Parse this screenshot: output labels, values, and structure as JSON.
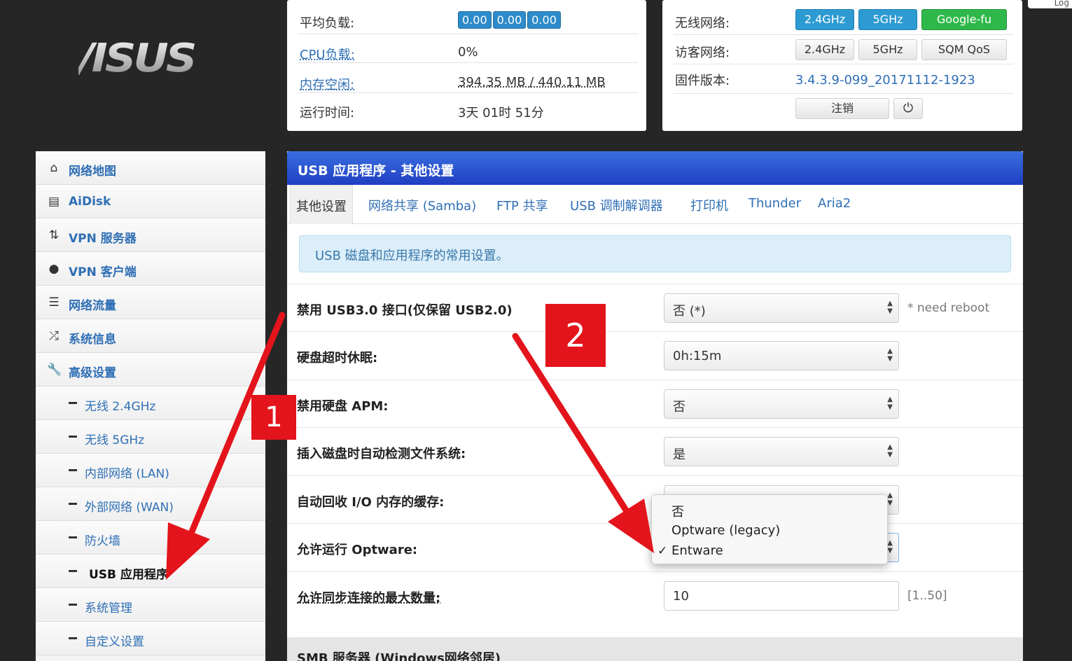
{
  "logo": {
    "text": "/ISUS"
  },
  "status_left": {
    "rows": [
      {
        "key": "平均负载:",
        "badges": [
          "0.00",
          "0.00",
          "0.00"
        ]
      },
      {
        "key": "CPU负载:",
        "value": "0%"
      },
      {
        "key": "内存空闲:",
        "value": "394.35 MB / 440.11 MB"
      },
      {
        "key": "运行时间:",
        "value": "3天 01时 51分"
      }
    ]
  },
  "status_right": {
    "wifi_label": "无线网络:",
    "wifi_buttons": [
      "2.4GHz",
      "5GHz",
      "Google-fu"
    ],
    "guest_label": "访客网络:",
    "guest_buttons": [
      "2.4GHz",
      "5GHz",
      "SQM QoS"
    ],
    "fw_label": "固件版本:",
    "fw_value": "3.4.3.9-099_20171112-1923",
    "logout": "注销",
    "power_icon": "⏻"
  },
  "corner": {
    "text": "Log"
  },
  "sidebar": {
    "items": [
      {
        "label": "网络地图",
        "icon": "home-icon"
      },
      {
        "label": "AiDisk",
        "icon": "disk-icon"
      },
      {
        "label": "VPN 服务器",
        "icon": "vpn-server-icon"
      },
      {
        "label": "VPN 客户端",
        "icon": "globe-icon"
      },
      {
        "label": "网络流量",
        "icon": "traffic-icon"
      },
      {
        "label": "系统信息",
        "icon": "shuffle-icon"
      },
      {
        "label": "高级设置",
        "icon": "wrench-icon"
      }
    ],
    "subitems": [
      {
        "label": "无线 2.4GHz"
      },
      {
        "label": "无线 5GHz"
      },
      {
        "label": "内部网络 (LAN)"
      },
      {
        "label": "外部网络 (WAN)"
      },
      {
        "label": "防火墙"
      },
      {
        "label": "USB 应用程序"
      },
      {
        "label": "系统管理"
      },
      {
        "label": "自定义设置"
      }
    ]
  },
  "main": {
    "title": "USB 应用程序 - 其他设置",
    "tabs": [
      "其他设置",
      "网络共享 (Samba)",
      "FTP 共享",
      "USB 调制解调器",
      "打印机",
      "Thunder",
      "Aria2"
    ],
    "info": "USB 磁盘和应用程序的常用设置。",
    "rows": [
      {
        "label": "禁用 USB3.0 接口(仅保留 USB2.0)",
        "value": "否 (*)",
        "note": "* need reboot"
      },
      {
        "label": "硬盘超时休眠:",
        "value": "0h:15m"
      },
      {
        "label": "禁用硬盘 APM:",
        "value": "否"
      },
      {
        "label": "插入磁盘时自动检测文件系统:",
        "value": "是"
      },
      {
        "label": "自动回收 I/O 内存的缓存:",
        "value": ""
      },
      {
        "label": "允许运行 Optware:",
        "value": ""
      },
      {
        "label": "允许同步连接的最大数量:",
        "value": "10",
        "note": "[1..50]"
      }
    ],
    "section": "SMB 服务器 (Windows网络邻居)"
  },
  "popup": {
    "options": [
      "否",
      "Optware (legacy)",
      "Entware"
    ],
    "checked": "✓"
  },
  "annotations": {
    "one": "1",
    "two": "2"
  },
  "colors": {
    "accent": "#2f6fb5",
    "header": "#2a52d0",
    "annotation": "#e3141b",
    "wifi_on": "#2d9bd2",
    "google": "#2fb84a"
  }
}
